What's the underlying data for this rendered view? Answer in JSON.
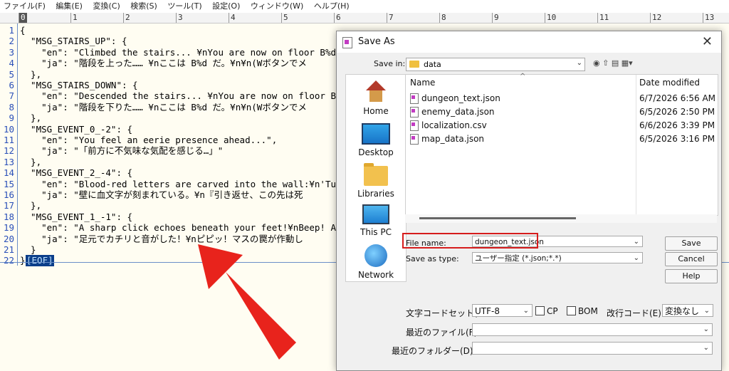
{
  "menu": [
    "ファイル(F)",
    "編集(E)",
    "変換(C)",
    "検索(S)",
    "ツール(T)",
    "設定(O)",
    "ウィンドウ(W)",
    "ヘルプ(H)"
  ],
  "ruler": [
    "0",
    "1",
    "2",
    "3",
    "4",
    "5",
    "6",
    "7",
    "8",
    "9",
    "10",
    "11",
    "12",
    "13"
  ],
  "lines": [
    {
      "n": "1",
      "t": "{"
    },
    {
      "n": "2",
      "t": "  \"MSG_STAIRS_UP\": {"
    },
    {
      "n": "3",
      "t": "    \"en\": \"Climbed the stairs... ¥nYou are now on floor B%d.\""
    },
    {
      "n": "4",
      "t": "    \"ja\": \"階段を上った…… ¥nここは B%d だ。¥n¥n(Wボタンでメ"
    },
    {
      "n": "5",
      "t": "  },"
    },
    {
      "n": "6",
      "t": "  \"MSG_STAIRS_DOWN\": {"
    },
    {
      "n": "7",
      "t": "    \"en\": \"Descended the stairs... ¥nYou are now on floor B%"
    },
    {
      "n": "8",
      "t": "    \"ja\": \"階段を下りた…… ¥nここは B%d だ。¥n¥n(Wボタンでメ"
    },
    {
      "n": "9",
      "t": "  },"
    },
    {
      "n": "10",
      "t": "  \"MSG_EVENT_0_-2\": {"
    },
    {
      "n": "11",
      "t": "    \"en\": \"You feel an eerie presence ahead...\","
    },
    {
      "n": "12",
      "t": "    \"ja\": \"「前方に不気味な気配を感じる…」\""
    },
    {
      "n": "13",
      "t": "  },"
    },
    {
      "n": "14",
      "t": "  \"MSG_EVENT_2_-4\": {"
    },
    {
      "n": "15",
      "t": "    \"en\": \"Blood-red letters are carved into the wall:¥n'Turn"
    },
    {
      "n": "16",
      "t": "    \"ja\": \"壁に血文字が刻まれている。¥n『引き返せ、この先は死"
    },
    {
      "n": "17",
      "t": "  },"
    },
    {
      "n": "18",
      "t": "  \"MSG_EVENT_1_-1\": {"
    },
    {
      "n": "19",
      "t": "    \"en\": \"A sharp click echoes beneath your feet!¥nBeep! A t"
    },
    {
      "n": "20",
      "t": "    \"ja\": \"足元でカチリと音がした！¥nピピッ！マスの罠が作動し"
    },
    {
      "n": "21",
      "t": "  }"
    },
    {
      "n": "22",
      "t": "}"
    }
  ],
  "eof_label": "[EOF]",
  "dialog": {
    "title": "Save As",
    "save_in_label": "Save in:",
    "save_in_value": "data",
    "columns": {
      "name": "Name",
      "date": "Date modified"
    },
    "files": [
      {
        "name": "dungeon_text.json",
        "date": "6/7/2026 6:56 AM"
      },
      {
        "name": "enemy_data.json",
        "date": "6/5/2026 2:50 PM"
      },
      {
        "name": "localization.csv",
        "date": "6/6/2026 3:39 PM"
      },
      {
        "name": "map_data.json",
        "date": "6/5/2026 3:16 PM"
      }
    ],
    "places": [
      "Home",
      "Desktop",
      "Libraries",
      "This PC",
      "Network"
    ],
    "file_name_label": "File name:",
    "file_name_value": "dungeon_text.json",
    "save_as_type_label": "Save as type:",
    "save_as_type_value": "ユーザー指定 (*.json;*.*)",
    "buttons": {
      "save": "Save",
      "cancel": "Cancel",
      "help": "Help"
    },
    "encoding_label": "文字コードセット(C",
    "encoding_value": "UTF-8",
    "cp_label": "CP",
    "bom_label": "BOM",
    "newline_label": "改行コード(E):",
    "newline_value": "変換なし",
    "recent_files_label": "最近のファイル(F):",
    "recent_folders_label": "最近のフォルダー(D):"
  },
  "colors": {
    "highlight_box": "#d61c1c",
    "arrow": "#e8231c",
    "line_number": "#2a4fb8"
  }
}
